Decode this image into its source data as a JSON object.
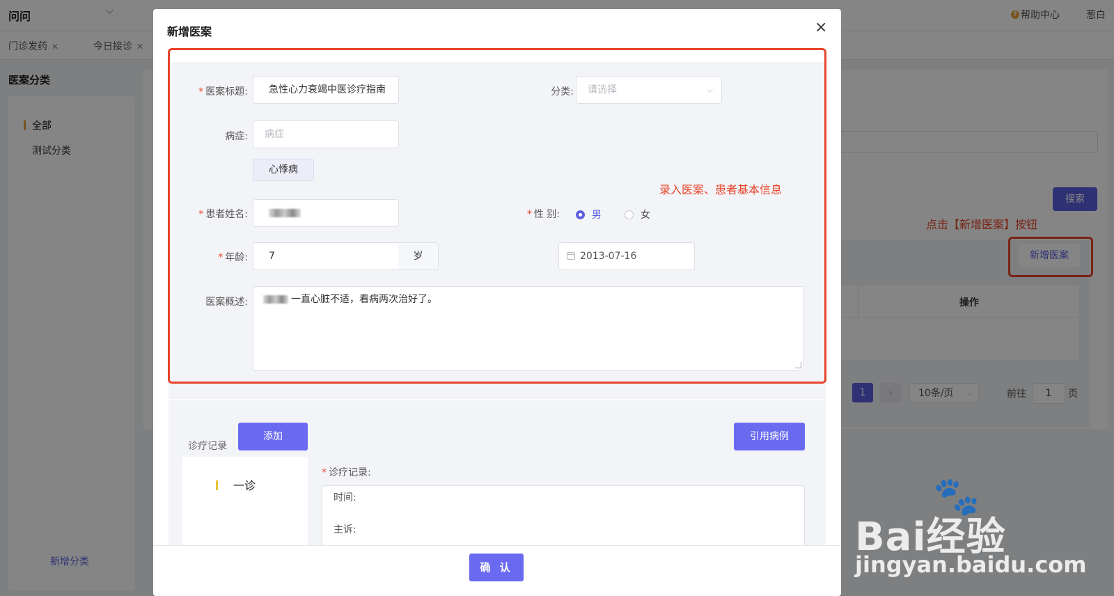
{
  "app": {
    "name": "问问",
    "help": "帮助中心",
    "user": "葱白"
  },
  "tabs": [
    {
      "label": "门诊发药"
    },
    {
      "label": "今日接诊"
    }
  ],
  "sidebar": {
    "title": "医案分类",
    "items": [
      {
        "label": "全部"
      },
      {
        "label": "测试分类"
      }
    ],
    "add_label": "新增分类"
  },
  "background": {
    "search_button": "搜索",
    "hint_click": "点击【新增医案】按钮",
    "new_case_button": "新增医案",
    "table_header_op": "操作",
    "pagination": {
      "current": "1",
      "page_size": "10条/页",
      "goto_label": "前往",
      "goto_value": "1",
      "page_suffix": "页"
    }
  },
  "modal": {
    "title": "新增医案",
    "annotation": "录入医案、患者基本信息",
    "fields": {
      "title_label": "医案标题:",
      "title_value": "急性心力衰竭中医诊疗指南",
      "category_label": "分类:",
      "category_placeholder": "请选择",
      "symptom_label": "病症:",
      "symptom_placeholder": "病症",
      "symptom_tag": "心悸病",
      "patient_label": "患者姓名:",
      "gender_label": "性 别:",
      "gender_male": "男",
      "gender_female": "女",
      "gender_selected": "男",
      "age_label": "年龄:",
      "age_value": "7",
      "age_suffix": "岁",
      "birth_date": "2013-07-16",
      "summary_label": "医案概述:",
      "summary_value": "一直心脏不适，看病两次治好了。"
    },
    "records": {
      "label": "诊疗记录",
      "add_button": "添加",
      "cite_button": "引用病例",
      "items": [
        {
          "label": "一诊"
        }
      ],
      "field_label": "诊疗记录:",
      "lines": [
        "时间:",
        "主诉:"
      ]
    },
    "confirm_button": "确 认"
  },
  "watermark": {
    "text": "Bai经验",
    "url": "jingyan.baidu.com"
  },
  "colors": {
    "primary": "#6a6af0",
    "annotation_red": "#e8442a",
    "accent_bar": "#e6a23c"
  }
}
